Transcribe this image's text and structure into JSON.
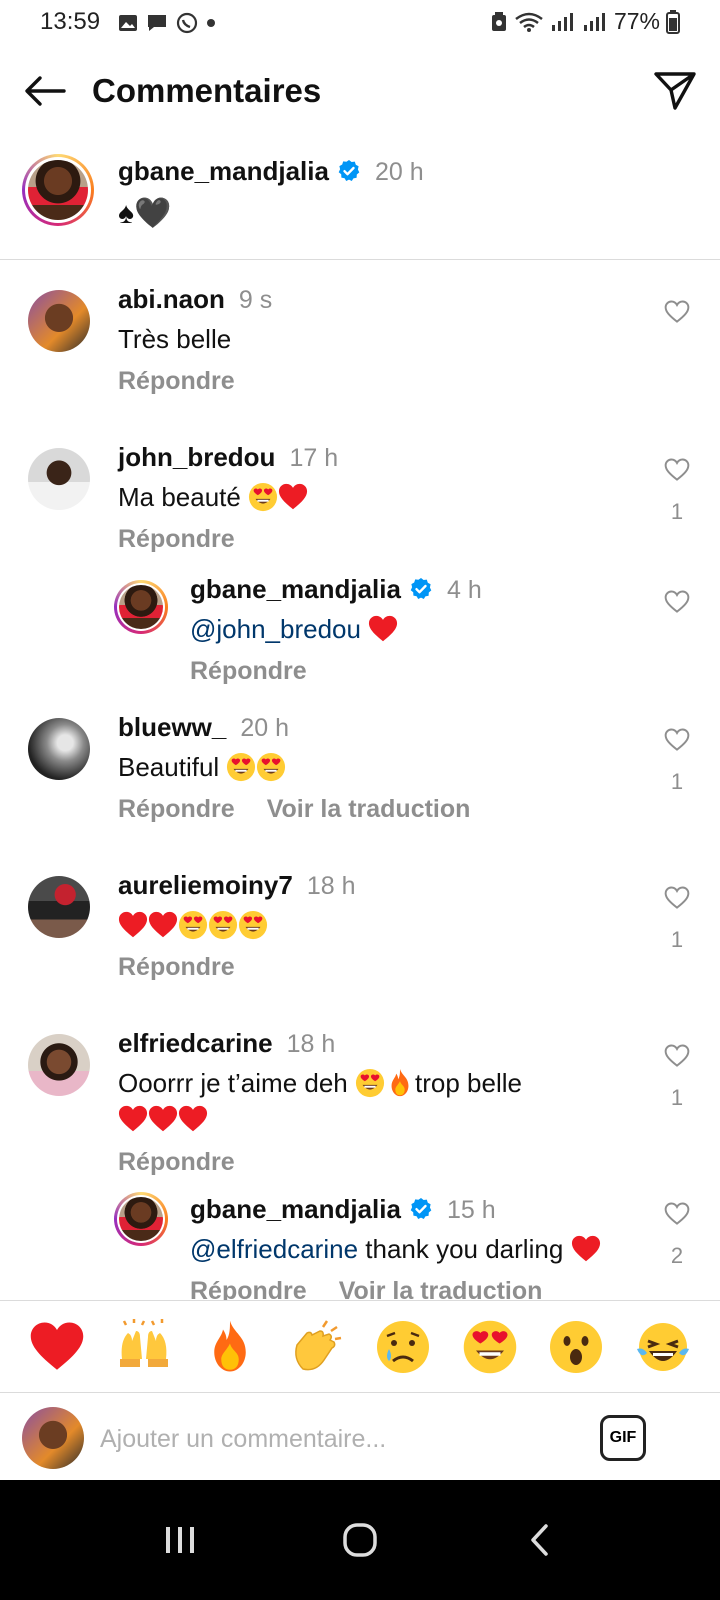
{
  "status_bar": {
    "time": "13:59",
    "battery": "77%"
  },
  "header": {
    "title": "Commentaires"
  },
  "caption": {
    "username": "gbane_mandjalia",
    "time": "20 h",
    "text": "♠🖤"
  },
  "comments": [
    {
      "username": "abi.naon",
      "time": "9 s",
      "text": "Très belle",
      "reply_label": "Répondre",
      "likes": ""
    },
    {
      "username": "john_bredou",
      "time": "17 h",
      "text": "Ma beauté",
      "reply_label": "Répondre",
      "likes": "1"
    },
    {
      "username": "gbane_mandjalia",
      "time": "4 h",
      "mention": "@john_bredou",
      "text": "",
      "reply_label": "Répondre",
      "likes": ""
    },
    {
      "username": "blueww_",
      "time": "20 h",
      "text": "Beautiful",
      "reply_label": "Répondre",
      "translate_label": "Voir la traduction",
      "likes": "1"
    },
    {
      "username": "aureliemoiny7",
      "time": "18 h",
      "text": "",
      "reply_label": "Répondre",
      "likes": "1"
    },
    {
      "username": "elfriedcarine",
      "time": "18 h",
      "text": "Ooorrr je t’aime deh",
      "text2": "trop belle",
      "reply_label": "Répondre",
      "likes": "1"
    },
    {
      "username": "gbane_mandjalia",
      "time": "15 h",
      "mention": "@elfriedcarine",
      "text": " thank you darling",
      "reply_label": "Répondre",
      "translate_label": "Voir la traduction",
      "likes": "2"
    }
  ],
  "reactions": [
    "heart-emoji",
    "raising-hands-emoji",
    "fire-emoji",
    "clapping-hands-emoji",
    "crying-face-emoji",
    "heart-eyes-emoji",
    "surprised-face-emoji",
    "laughing-tears-emoji"
  ],
  "composer": {
    "placeholder": "Ajouter un commentaire...",
    "gif_label": "GIF"
  },
  "colors": {
    "mention": "#00376b",
    "muted": "#8e8e8e",
    "verified": "#0095f6",
    "heart": "#ed1c24"
  }
}
